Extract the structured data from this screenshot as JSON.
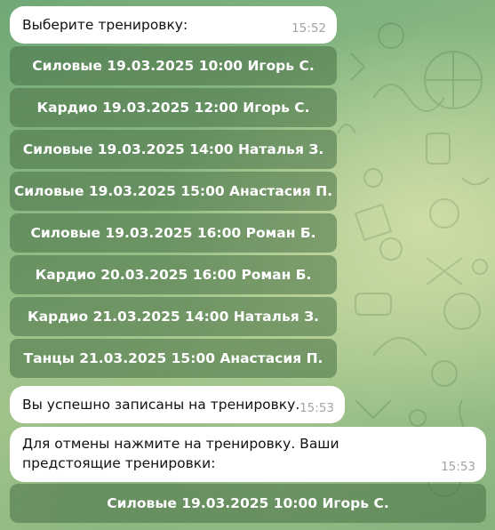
{
  "messages": {
    "choose": {
      "text": "Выберите тренировку:",
      "time": "15:52"
    },
    "success": {
      "text": "Вы успешно записаны на тренировку.",
      "time": "15:53"
    },
    "cancel": {
      "text": "Для отмены нажмите на тренировку. Ваши предстоящие тренировки:",
      "time": "15:53"
    }
  },
  "keyboard_choose": [
    "Силовые 19.03.2025 10:00 Игорь С.",
    "Кардио 19.03.2025 12:00 Игорь С.",
    "Силовые 19.03.2025 14:00 Наталья З.",
    "Силовые 19.03.2025 15:00 Анастасия П.",
    "Силовые 19.03.2025 16:00 Роман Б.",
    "Кардио 20.03.2025 16:00 Роман Б.",
    "Кардио 21.03.2025 14:00 Наталья З.",
    "Танцы 21.03.2025 15:00 Анастасия П."
  ],
  "keyboard_upcoming": [
    "Силовые 19.03.2025 10:00 Игорь С."
  ]
}
